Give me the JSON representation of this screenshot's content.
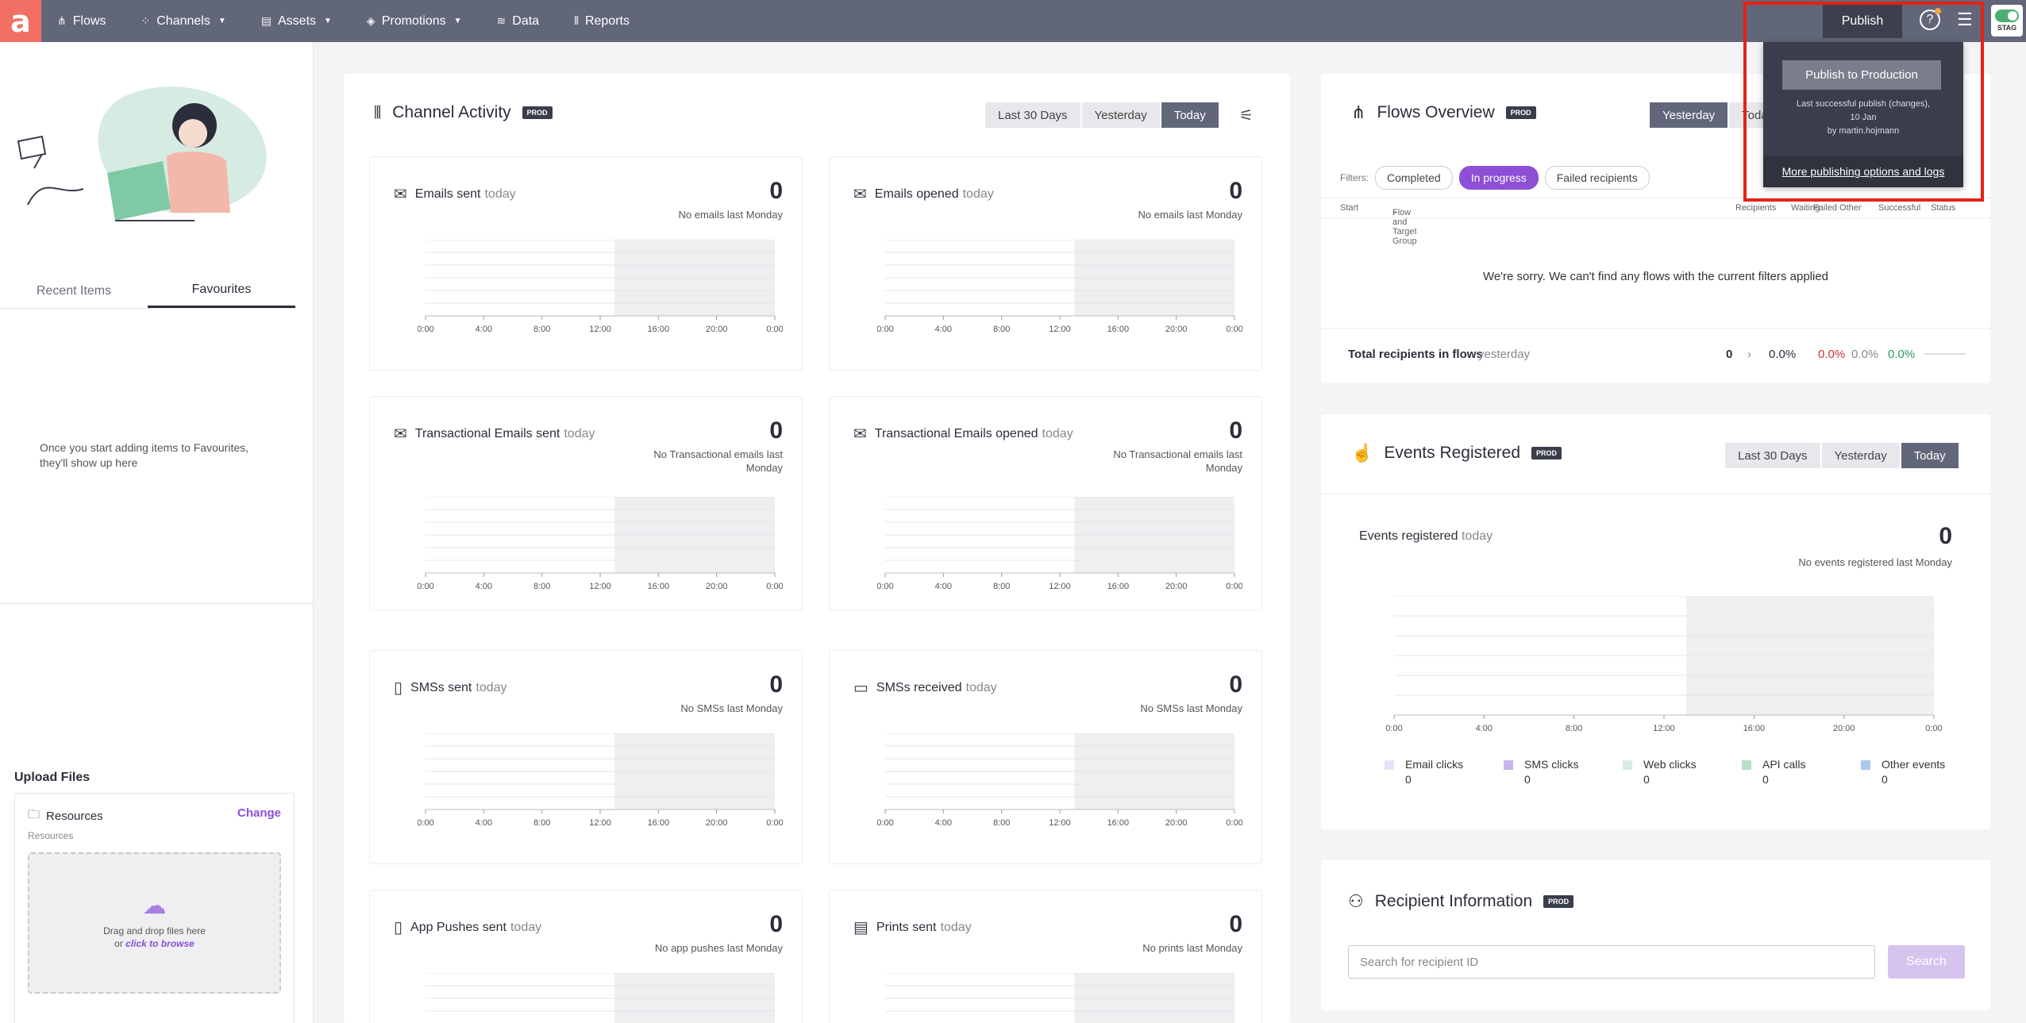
{
  "nav": {
    "logo": "a",
    "items": [
      {
        "label": "Flows",
        "icon": "flows-icon",
        "glyph": "⋔",
        "chevron": false
      },
      {
        "label": "Channels",
        "icon": "channels-icon",
        "glyph": "⁘",
        "chevron": true
      },
      {
        "label": "Assets",
        "icon": "assets-icon",
        "glyph": "▤",
        "chevron": true
      },
      {
        "label": "Promotions",
        "icon": "promotions-icon",
        "glyph": "◈",
        "chevron": true
      },
      {
        "label": "Data",
        "icon": "database-icon",
        "glyph": "≋",
        "chevron": false
      },
      {
        "label": "Reports",
        "icon": "reports-icon",
        "glyph": "⫴",
        "chevron": false
      }
    ],
    "publish": "Publish",
    "env": "STAG"
  },
  "publish_popup": {
    "button": "Publish to Production",
    "line1": "Last successful publish (changes),",
    "line2": "10 Jan",
    "line3": "by martin.hojmann",
    "link": "More publishing options and logs"
  },
  "left": {
    "tabs": [
      "Recent Items",
      "Favourites"
    ],
    "empty": "Once you start adding items to Favourites, they'll show up here",
    "upload_title": "Upload Files",
    "folder": "Resources",
    "change": "Change",
    "sub": "Resources",
    "drop1": "Drag and drop files here",
    "drop_or": "or",
    "drop_link": "click to browse"
  },
  "channel": {
    "title": "Channel Activity",
    "badge": "PROD",
    "ranges": [
      "Last 30 Days",
      "Yesterday",
      "Today"
    ],
    "active_range": "Today"
  },
  "axis_ticks": [
    "0:00",
    "4:00",
    "8:00",
    "12:00",
    "16:00",
    "20:00",
    "0:00"
  ],
  "cards": [
    {
      "title": "Emails sent",
      "today": "today",
      "value": "0",
      "sub": "No emails last Monday",
      "icon": "email-sent-icon",
      "glyph": "✉"
    },
    {
      "title": "Emails opened",
      "today": "today",
      "value": "0",
      "sub": "No emails last Monday",
      "icon": "email-opened-icon",
      "glyph": "✉"
    },
    {
      "title": "Transactional Emails sent",
      "today": "today",
      "value": "0",
      "sub": "No Transactional emails last Monday",
      "icon": "transactional-email-icon",
      "glyph": "✉"
    },
    {
      "title": "Transactional Emails opened",
      "today": "today",
      "value": "0",
      "sub": "No Transactional emails last Monday",
      "icon": "transactional-opened-icon",
      "glyph": "✉"
    },
    {
      "title": "SMSs sent",
      "today": "today",
      "value": "0",
      "sub": "No SMSs last Monday",
      "icon": "sms-sent-icon",
      "glyph": "▯"
    },
    {
      "title": "SMSs received",
      "today": "today",
      "value": "0",
      "sub": "No SMSs last Monday",
      "icon": "sms-received-icon",
      "glyph": "▭"
    },
    {
      "title": "App Pushes sent",
      "today": "today",
      "value": "0",
      "sub": "No app pushes last Monday",
      "icon": "app-push-icon",
      "glyph": "▯"
    },
    {
      "title": "Prints sent",
      "today": "today",
      "value": "0",
      "sub": "No prints last Monday",
      "icon": "print-icon",
      "glyph": "▤"
    }
  ],
  "flows": {
    "title": "Flows Overview",
    "badge": "PROD",
    "ranges": [
      "Yesterday",
      "Today"
    ],
    "filters_label": "Filters:",
    "filters": [
      "Completed",
      "In progress",
      "Failed recipients"
    ],
    "active_filter": "In progress",
    "cols": {
      "start": "Start",
      "search": "Flow and Target Group",
      "recipients": "Recipients",
      "waiting": "Waiting",
      "failed": "Failed Other",
      "successful": "Successful",
      "status": "Status"
    },
    "empty": "We're sorry. We can't find any flows with the current filters applied",
    "total_label": "Total recipients in flows",
    "total_when": "yesterday",
    "total": "0",
    "pct1": "0.0%",
    "pct2": "0.0%",
    "pct3": "0.0%",
    "pct4": "0.0%"
  },
  "events": {
    "title": "Events Registered",
    "badge": "PROD",
    "ranges": [
      "Last 30 Days",
      "Yesterday",
      "Today"
    ],
    "card_title": "Events registered",
    "today": "today",
    "value": "0",
    "sub": "No events registered last Monday",
    "legend": [
      {
        "label": "Email clicks",
        "value": "0",
        "color": "#e8e0f7"
      },
      {
        "label": "SMS clicks",
        "value": "0",
        "color": "#c9b3ef"
      },
      {
        "label": "Web clicks",
        "value": "0",
        "color": "#d6ece2"
      },
      {
        "label": "API calls",
        "value": "0",
        "color": "#b7e0c8"
      },
      {
        "label": "Other events",
        "value": "0",
        "color": "#a9c9f3"
      }
    ]
  },
  "recipient": {
    "title": "Recipient Information",
    "badge": "PROD",
    "placeholder": "Search for recipient ID",
    "button": "Search"
  },
  "colors": {
    "accent": "#8c4fd6",
    "topbar": "#626679",
    "logo": "#f26f63",
    "highlight": "#e62117"
  }
}
